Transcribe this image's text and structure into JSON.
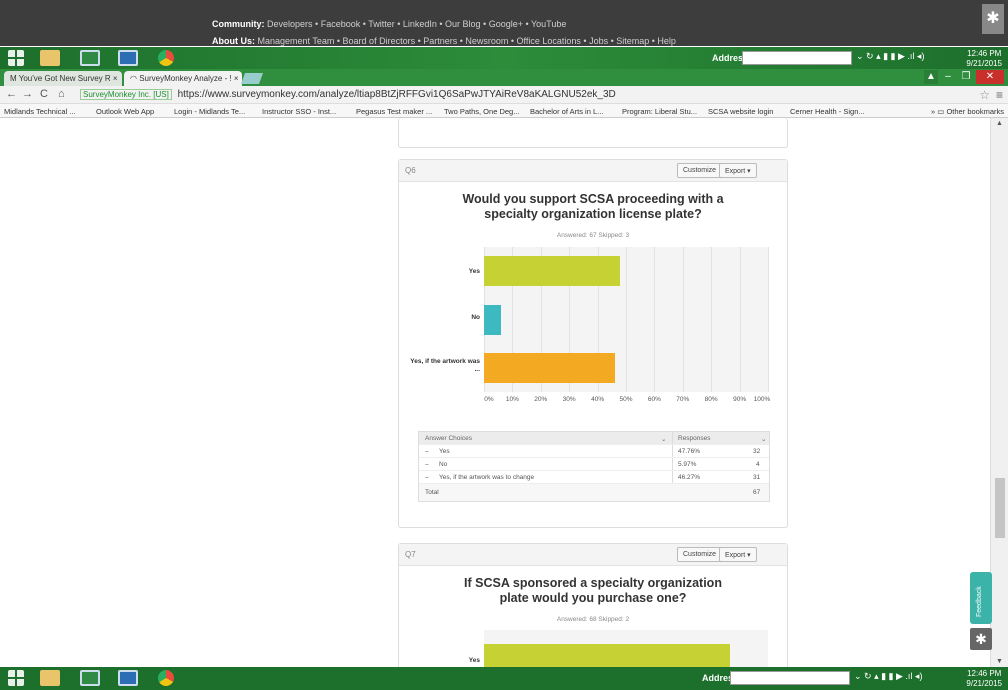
{
  "sm_footer": {
    "community_label": "Community:",
    "community_links": "Developers • Facebook • Twitter • LinkedIn • Our Blog • Google+ • YouTube",
    "about_label": "About Us:",
    "about_links": "Management Team • Board of Directors • Partners • Newsroom • Office Locations • Jobs • Sitemap • Help"
  },
  "taskbar": {
    "address_label": "Address",
    "time": "12:46 PM",
    "date": "9/21/2015",
    "tray": "⌄ ↻ ▴ ▮ ▮ ▶ .ıl ◂)"
  },
  "tabs": [
    {
      "label": "M You've Got New Survey R ×"
    },
    {
      "label": "◠ SurveyMonkey Analyze - ! ×"
    }
  ],
  "window_controls": {
    "pin": "▲",
    "minimize": "–",
    "restore": "❐",
    "close": "✕"
  },
  "omnibar": {
    "back": "←",
    "forward": "→",
    "reload": "C",
    "home": "⌂",
    "secure_label": "SurveyMonkey Inc. [US]",
    "url": "https://www.surveymonkey.com/analyze/ltiap8BtZjRFFGvi1Q6SaPwJTYAiReV8aKALGNU52ek_3D",
    "star": "☆",
    "menu": "≡"
  },
  "bookmarks": [
    "Midlands Technical ...",
    "Outlook Web App",
    "Login - Midlands Te...",
    "Instructor SSO - Inst...",
    "Pegasus Test maker ...",
    "Two Paths, One Deg...",
    "Bachelor of Arts in L...",
    "Program: Liberal Stu...",
    "SCSA website login",
    "Cerner Health - Sign..."
  ],
  "bookmarks_other": "» ▭ Other bookmarks",
  "q6": {
    "num": "Q6",
    "customize": "Customize",
    "export": "Export ▾",
    "title_line1": "Would you support SCSA proceeding with a",
    "title_line2": "specialty organization license plate?",
    "meta": "Answered: 67    Skipped: 3",
    "chart_labels": [
      "Yes",
      "No",
      "Yes, if the artwork was ..."
    ],
    "table": {
      "col1": "Answer Choices",
      "col2": "Responses",
      "sort1": "⌄",
      "sort2": "⌄",
      "rows": [
        {
          "choice": "Yes",
          "pct": "47.76%",
          "count": "32"
        },
        {
          "choice": "No",
          "pct": "5.97%",
          "count": "4"
        },
        {
          "choice": "Yes, if the artwork was to change",
          "pct": "46.27%",
          "count": "31"
        }
      ],
      "total_label": "Total",
      "total": "67"
    }
  },
  "q7": {
    "num": "Q7",
    "customize": "Customize",
    "export": "Export ▾",
    "title_line1": "If SCSA sponsored a specialty organization",
    "title_line2": "plate would you purchase one?",
    "meta": "Answered: 68    Skipped: 2",
    "chart_label_first": "Yes"
  },
  "feedback": "Feedback",
  "chart_data": [
    {
      "type": "bar",
      "orientation": "horizontal",
      "categories": [
        "Yes",
        "No",
        "Yes, if the artwork was ..."
      ],
      "values": [
        47.76,
        5.97,
        46.27
      ],
      "colors": [
        "#c6d233",
        "#3cb9c1",
        "#f4a922"
      ],
      "xlim": [
        0,
        100
      ],
      "xticks": [
        "0%",
        "10%",
        "20%",
        "30%",
        "40%",
        "50%",
        "60%",
        "70%",
        "80%",
        "90%",
        "100%"
      ],
      "grid": true
    }
  ],
  "colors": {
    "yes": "#c6d233",
    "no": "#3cb9c1",
    "conditional": "#f4a922",
    "taskbar": "#1d6f2c",
    "feedback": "#3bb3a9"
  }
}
